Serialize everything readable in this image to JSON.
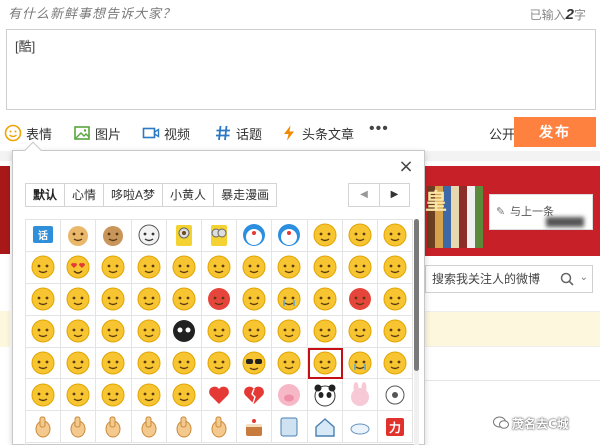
{
  "composer": {
    "prompt": "有什么新鲜事想告诉大家？",
    "counter_prefix": "已输入",
    "counter_value": "2",
    "counter_suffix": "字",
    "text": "[酷]"
  },
  "toolbar": {
    "emoji_label": "表情",
    "image_label": "图片",
    "video_label": "视频",
    "topic_label": "话题",
    "article_label": "头条文章",
    "more_label": "•••",
    "visibility_label": "公开",
    "publish_label": "发布"
  },
  "background": {
    "banner_glyph": "皇",
    "card_text": "与上一条",
    "search_placeholder": "搜索我关注人的微博",
    "watermark": "茂名去C城"
  },
  "picker": {
    "tabs": [
      "默认",
      "心情",
      "哆啦A梦",
      "小黄人",
      "暴走漫画"
    ],
    "active_tab": 0,
    "pager_prev": "◀",
    "pager_next": "▶",
    "close_label": "×",
    "selected_index": 52,
    "emojis": [
      "weibo-badge-icon",
      "doge-icon",
      "cat-meow-icon",
      "troll-face-icon",
      "minion-eye-icon",
      "minion-goggles-icon",
      "doraemon-icon",
      "doraemon-cry-icon",
      "laugh-icon",
      "smirk-icon",
      "peek-icon",
      "grin-teeth-icon",
      "heart-eyes-icon",
      "pray-icon",
      "lick-icon",
      "grimace-icon",
      "wink-tongue-icon",
      "chuckle-icon",
      "dizzy-icon",
      "smile-icon",
      "tongue-out-icon",
      "shy-icon",
      "sleepy-icon",
      "shocked-icon",
      "think-icon",
      "wave-icon",
      "frown-icon",
      "angry-red-icon",
      "sad-sweat-icon",
      "sob-icon",
      "thumb-blush-icon",
      "rage-icon",
      "bored-icon",
      "nose-pick-icon",
      "confused-icon",
      "mock-icon",
      "side-eye-icon",
      "black-face-icon",
      "question-icon",
      "masked-icon",
      "worried-icon",
      "giggle-icon",
      "faint-icon",
      "whisper-icon",
      "silly-icon",
      "sideways-icon",
      "angry-icon",
      "ugh-icon",
      "money-icon",
      "kiss-icon",
      "sunglasses-cool-icon",
      "yawn-icon",
      "sneer-icon",
      "laugh-cry-icon",
      "shush-icon",
      "cheeky-icon",
      "sulk-icon",
      "awkward-icon",
      "sweat-icon",
      "blush-icon",
      "heart-icon",
      "broken-heart-icon",
      "pig-icon",
      "panda-icon",
      "rabbit-icon",
      "circle-dot-icon",
      "victory-hand-icon",
      "ok-hand-icon",
      "thumbs-up-icon",
      "point-icon",
      "fist-icon",
      "thumbs-down-icon",
      "cake-icon",
      "scroll-icon",
      "house-icon",
      "cloud-icon",
      "power-badge-icon"
    ]
  }
}
